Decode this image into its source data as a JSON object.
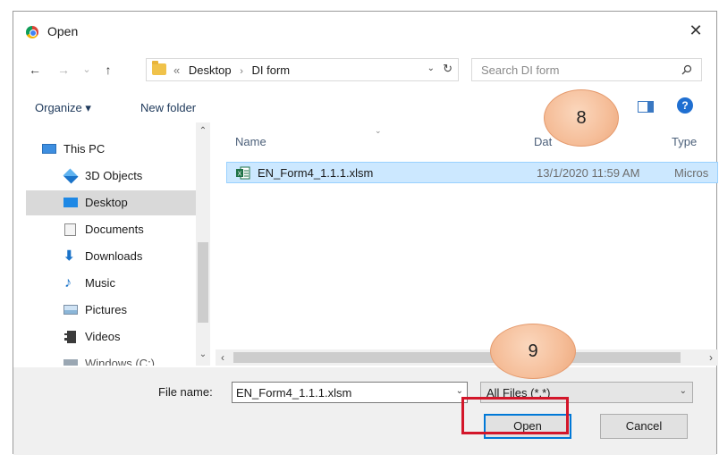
{
  "title_bar": {
    "title": "Open",
    "close_glyph": "✕",
    "app_icon": "chrome-icon"
  },
  "address_bar": {
    "back_glyph": "←",
    "forward_glyph": "→",
    "recent_glyph": "⌄",
    "up_glyph": "↑",
    "overflow": "«",
    "breadcrumbs": [
      "Desktop",
      "DI form"
    ],
    "separator": "›",
    "dropdown_glyph": "⌄",
    "refresh_glyph": "↻"
  },
  "search": {
    "placeholder": "Search DI form"
  },
  "toolbar": {
    "organize_label": "Organize ▾",
    "new_folder_label": "New folder",
    "help_glyph": "?"
  },
  "nav_pane": {
    "items": [
      {
        "label": "This PC",
        "icon": "pc-icon"
      },
      {
        "label": "3D Objects",
        "icon": "3d-objects-icon"
      },
      {
        "label": "Desktop",
        "icon": "desktop-icon",
        "selected": true
      },
      {
        "label": "Documents",
        "icon": "documents-icon"
      },
      {
        "label": "Downloads",
        "icon": "downloads-icon"
      },
      {
        "label": "Music",
        "icon": "music-icon"
      },
      {
        "label": "Pictures",
        "icon": "pictures-icon"
      },
      {
        "label": "Videos",
        "icon": "videos-icon"
      },
      {
        "label": "Windows (C:)",
        "icon": "drive-icon"
      }
    ],
    "scroll_up": "⌃",
    "scroll_down": "⌄"
  },
  "file_list": {
    "columns": {
      "name": "Name",
      "date": "Dat",
      "type": "Type"
    },
    "files": [
      {
        "name": "EN_Form4_1.1.1.xlsm",
        "date": "13/1/2020 11:59 AM",
        "type": "Micros",
        "icon": "excel-macro-icon",
        "selected": true
      }
    ],
    "scroll_left": "‹",
    "scroll_right": "›"
  },
  "bottom_bar": {
    "file_name_label": "File name:",
    "file_name_value": "EN_Form4_1.1.1.xlsm",
    "file_type_value": "All Files (*.*)",
    "open_label": "Open",
    "cancel_label": "Cancel"
  },
  "annotations": {
    "step_8": "8",
    "step_9": "9"
  },
  "colors": {
    "highlight_border": "#d3162a",
    "selection_bg": "#cce8ff",
    "callout_fill": "#f5bd98"
  }
}
